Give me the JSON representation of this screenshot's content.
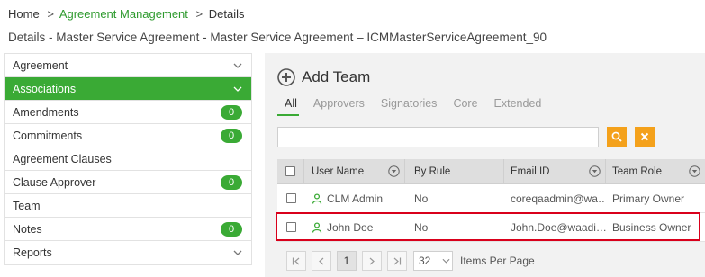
{
  "breadcrumb": {
    "home": "Home",
    "sep1": ">",
    "agreement_management": "Agreement Management",
    "sep2": ">",
    "details": "Details"
  },
  "page_title": "Details -  Master Service Agreement - Master Service Agreement – ICMMasterServiceAgreement_90",
  "sidebar": {
    "items": [
      {
        "label": "Agreement",
        "badge": null
      },
      {
        "label": "Associations",
        "badge": null
      },
      {
        "label": "Amendments",
        "badge": "0"
      },
      {
        "label": "Commitments",
        "badge": "0"
      },
      {
        "label": "Agreement Clauses",
        "badge": null
      },
      {
        "label": "Clause Approver",
        "badge": "0"
      },
      {
        "label": "Team",
        "badge": null
      },
      {
        "label": "Notes",
        "badge": "0"
      },
      {
        "label": "Reports",
        "badge": null
      }
    ]
  },
  "main": {
    "add_team_label": "Add Team",
    "tabs": [
      "All",
      "Approvers",
      "Signatories",
      "Core",
      "Extended"
    ],
    "search_placeholder": "",
    "table": {
      "headers": [
        "User Name",
        "By Rule",
        "Email ID",
        "Team Role"
      ],
      "rows": [
        {
          "user": "CLM Admin",
          "by_rule": "No",
          "email": "coreqaadmin@wa…",
          "role": "Primary Owner"
        },
        {
          "user": "John Doe",
          "by_rule": "No",
          "email": "John.Doe@waadi…",
          "role": "Business Owner"
        }
      ]
    },
    "pager": {
      "first": "K",
      "prev": "<",
      "page": "1",
      "next": ">",
      "last": "K",
      "page_size": "32",
      "items_per_page_label": "Items Per Page"
    }
  },
  "colors": {
    "accent_green": "#3aaa35",
    "link_green": "#2e9a2e",
    "orange": "#f4a11b",
    "highlight_red": "#d9001b"
  }
}
